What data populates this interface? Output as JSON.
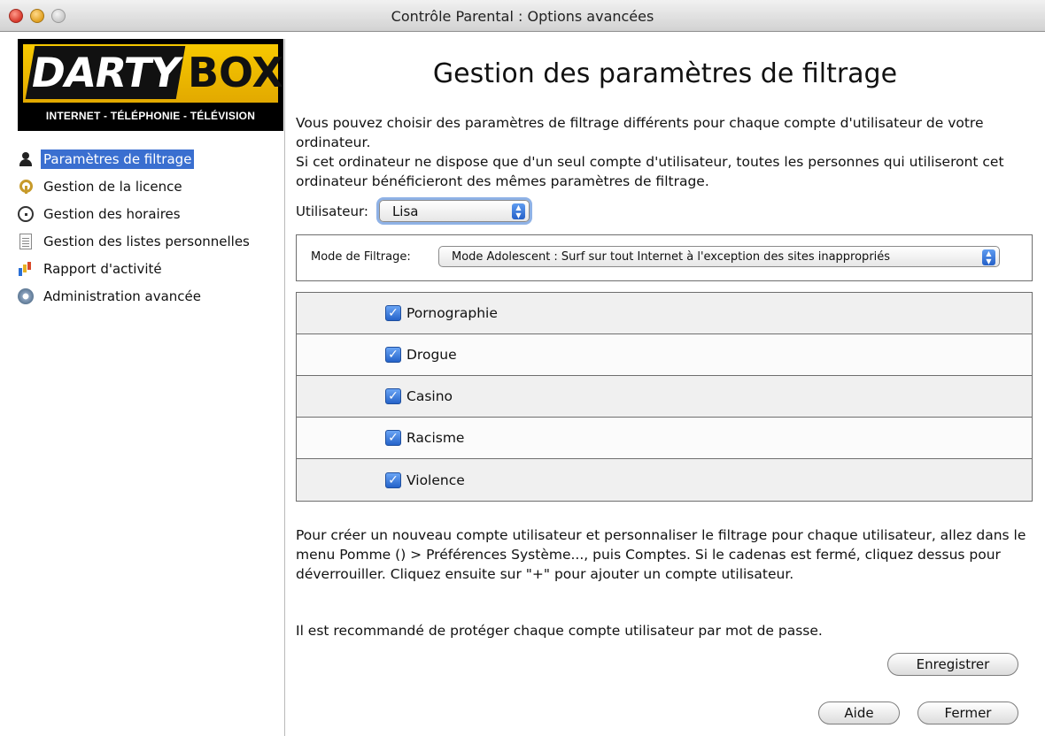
{
  "window": {
    "title": "Contrôle Parental : Options avancées"
  },
  "logo": {
    "brand_left": "DARTY",
    "brand_right": "BOX",
    "tagline": "INTERNET - TÉLÉPHONIE - TÉLÉVISION"
  },
  "sidebar": {
    "items": [
      {
        "label": "Paramètres de filtrage",
        "icon": "person-icon",
        "selected": true
      },
      {
        "label": "Gestion de la licence",
        "icon": "keys-icon",
        "selected": false
      },
      {
        "label": "Gestion des horaires",
        "icon": "clock-icon",
        "selected": false
      },
      {
        "label": "Gestion des listes personnelles",
        "icon": "document-icon",
        "selected": false
      },
      {
        "label": "Rapport d'activité",
        "icon": "chart-icon",
        "selected": false
      },
      {
        "label": "Administration avancée",
        "icon": "gear-icon",
        "selected": false
      }
    ]
  },
  "main": {
    "title": "Gestion des paramètres de filtrage",
    "intro_line1": "Vous pouvez choisir des paramètres de filtrage différents pour chaque compte d'utilisateur de votre ordinateur.",
    "intro_line2": "Si cet ordinateur ne dispose que d'un seul compte d'utilisateur, toutes les personnes qui utiliseront cet ordinateur bénéficieront des mêmes paramètres de filtrage.",
    "user_label": "Utilisateur:",
    "user_value": "Lisa",
    "mode_label": "Mode de Filtrage:",
    "mode_value": "Mode Adolescent : Surf sur tout Internet à l'exception des sites inappropriés",
    "categories": [
      {
        "label": "Pornographie",
        "checked": true
      },
      {
        "label": "Drogue",
        "checked": true
      },
      {
        "label": "Casino",
        "checked": true
      },
      {
        "label": "Racisme",
        "checked": true
      },
      {
        "label": "Violence",
        "checked": true
      }
    ],
    "help_text": "Pour créer un nouveau compte utilisateur et personnaliser le filtrage pour chaque utilisateur, allez dans le menu Pomme () > Préférences Système..., puis Comptes. Si le cadenas est fermé, cliquez dessus pour déverrouiller. Cliquez ensuite sur \"+\" pour ajouter un compte utilisateur.",
    "recommendation": "Il est recommandé de protéger chaque compte utilisateur par mot de passe."
  },
  "buttons": {
    "save": "Enregistrer",
    "help": "Aide",
    "close": "Fermer"
  },
  "colors": {
    "selection": "#3a6fd0",
    "checkbox": "#2563c9"
  }
}
